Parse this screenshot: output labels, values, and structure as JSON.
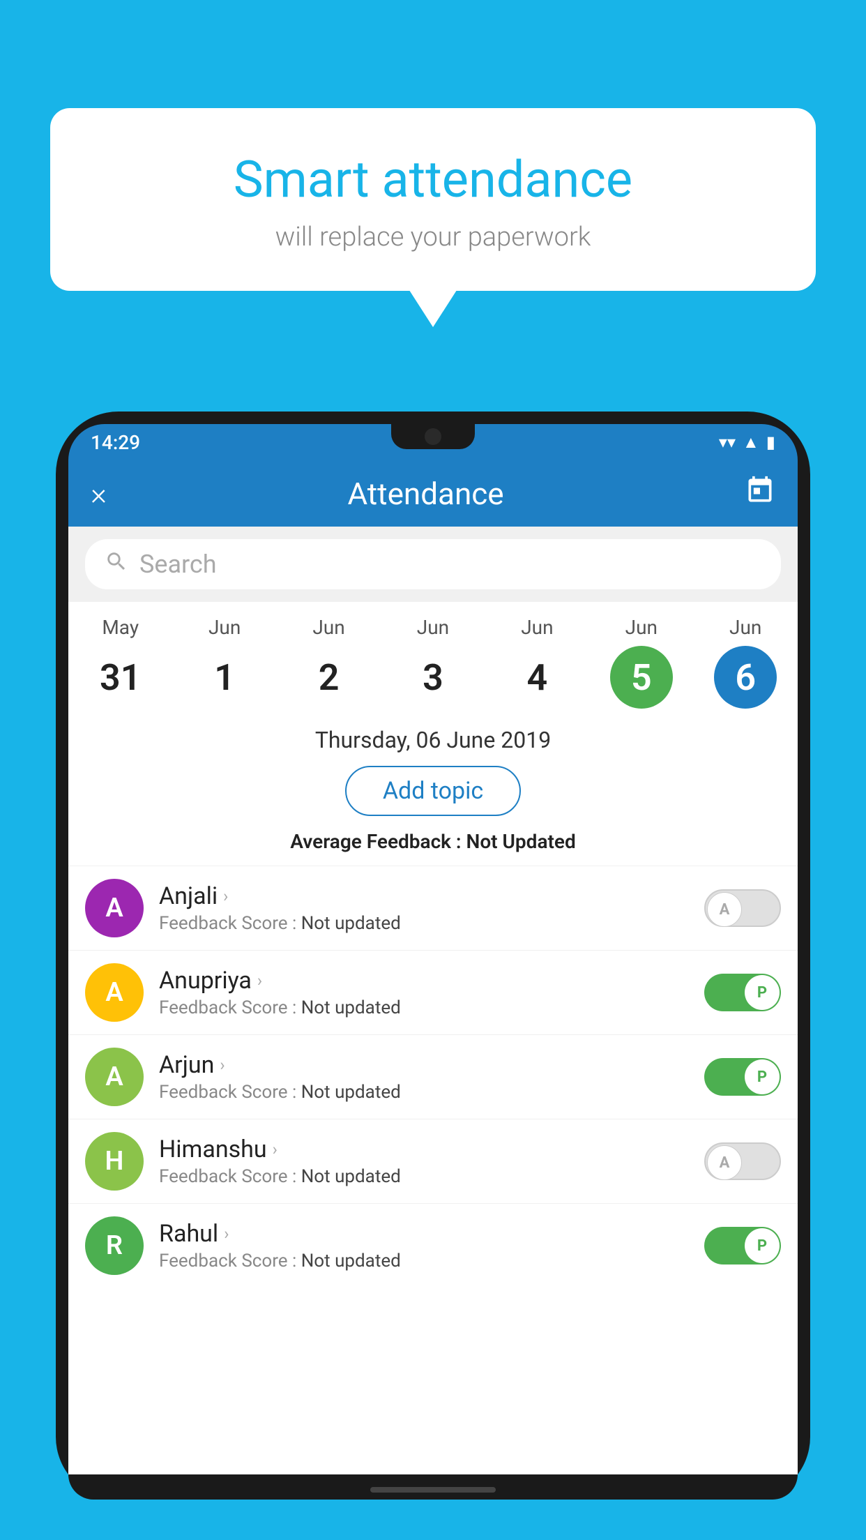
{
  "background_color": "#18B4E8",
  "speech_bubble": {
    "title": "Smart attendance",
    "subtitle": "will replace your paperwork"
  },
  "status_bar": {
    "time": "14:29",
    "wifi": "▼",
    "signal": "▲",
    "battery": "▮"
  },
  "header": {
    "close_label": "×",
    "title": "Attendance",
    "calendar_icon": "📅"
  },
  "search": {
    "placeholder": "Search"
  },
  "dates": [
    {
      "month": "May",
      "day": "31",
      "highlight": "none"
    },
    {
      "month": "Jun",
      "day": "1",
      "highlight": "none"
    },
    {
      "month": "Jun",
      "day": "2",
      "highlight": "none"
    },
    {
      "month": "Jun",
      "day": "3",
      "highlight": "none"
    },
    {
      "month": "Jun",
      "day": "4",
      "highlight": "none"
    },
    {
      "month": "Jun",
      "day": "5",
      "highlight": "today"
    },
    {
      "month": "Jun",
      "day": "6",
      "highlight": "selected"
    }
  ],
  "selected_date_label": "Thursday, 06 June 2019",
  "add_topic_label": "Add topic",
  "avg_feedback_label": "Average Feedback : ",
  "avg_feedback_value": "Not Updated",
  "students": [
    {
      "name": "Anjali",
      "avatar_letter": "A",
      "avatar_color": "#9C27B0",
      "feedback_label": "Feedback Score : ",
      "feedback_value": "Not updated",
      "toggle_state": "off",
      "toggle_letter": "A"
    },
    {
      "name": "Anupriya",
      "avatar_letter": "A",
      "avatar_color": "#FFC107",
      "feedback_label": "Feedback Score : ",
      "feedback_value": "Not updated",
      "toggle_state": "on",
      "toggle_letter": "P"
    },
    {
      "name": "Arjun",
      "avatar_letter": "A",
      "avatar_color": "#8BC34A",
      "feedback_label": "Feedback Score : ",
      "feedback_value": "Not updated",
      "toggle_state": "on",
      "toggle_letter": "P"
    },
    {
      "name": "Himanshu",
      "avatar_letter": "H",
      "avatar_color": "#8BC34A",
      "feedback_label": "Feedback Score : ",
      "feedback_value": "Not updated",
      "toggle_state": "off",
      "toggle_letter": "A"
    },
    {
      "name": "Rahul",
      "avatar_letter": "R",
      "avatar_color": "#4CAF50",
      "feedback_label": "Feedback Score : ",
      "feedback_value": "Not updated",
      "toggle_state": "on",
      "toggle_letter": "P"
    }
  ]
}
